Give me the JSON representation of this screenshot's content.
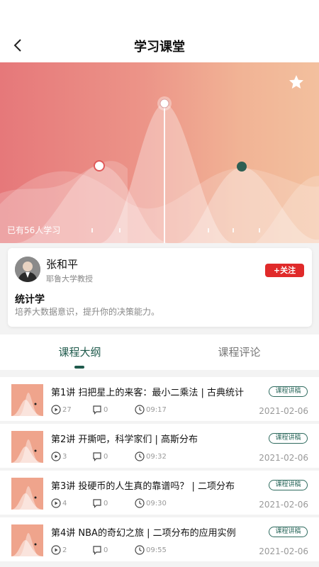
{
  "header": {
    "title": "学习课堂"
  },
  "hero": {
    "learners_text": "已有56人学习"
  },
  "teacher": {
    "name": "张和平",
    "title": "耶鲁大学教授",
    "follow_label": "+关注"
  },
  "course": {
    "name": "统计学",
    "description": "培养大数据意识，提升你的决策能力。"
  },
  "tabs": [
    {
      "label": "课程大纲",
      "active": true
    },
    {
      "label": "课程评论",
      "active": false
    }
  ],
  "lectures": [
    {
      "title": "第1讲  扫把星上的来客：最小二乘法 | 古典统计",
      "badge": "课程讲稿",
      "plays": "27",
      "comments": "0",
      "duration": "09:17",
      "date": "2021-02-06"
    },
    {
      "title": "第2讲  开撕吧，科学家们 | 高斯分布",
      "badge": "课程讲稿",
      "plays": "3",
      "comments": "0",
      "duration": "09:32",
      "date": "2021-02-06"
    },
    {
      "title": "第3讲  投硬币的人生真的靠谱吗？ | 二项分布",
      "badge": "课程讲稿",
      "plays": "4",
      "comments": "0",
      "duration": "09:30",
      "date": "2021-02-06"
    },
    {
      "title": "第4讲  NBA的奇幻之旅 | 二项分布的应用实例",
      "badge": "课程讲稿",
      "plays": "2",
      "comments": "0",
      "duration": "09:55",
      "date": "2021-02-06"
    }
  ],
  "colors": {
    "accent": "#1f5a4c",
    "follow": "#e02a2a",
    "hero_left": "#e6787a",
    "hero_right": "#f3c09e"
  },
  "icons": [
    "back-arrow-icon",
    "star-icon",
    "play-icon",
    "comment-icon",
    "clock-icon"
  ]
}
